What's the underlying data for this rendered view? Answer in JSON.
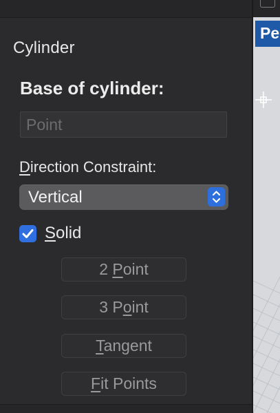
{
  "panel": {
    "title": "Cylinder",
    "base_label": "Base of cylinder:",
    "point_placeholder": "Point",
    "direction_label": {
      "mnemonic": "D",
      "rest": "irection Constraint:"
    },
    "direction_value": "Vertical",
    "solid": {
      "checked": true,
      "mnemonic": "S",
      "rest": "olid"
    },
    "buttons": {
      "two_point": {
        "pre": "2 ",
        "mnemonic": "P",
        "post": "oint"
      },
      "three_point": {
        "pre": "3 P",
        "mnemonic": "o",
        "post": "int"
      },
      "tangent": {
        "pre": "",
        "mnemonic": "T",
        "post": "angent"
      },
      "fit_points": {
        "pre": "",
        "mnemonic": "F",
        "post": "it Points"
      }
    }
  },
  "viewport": {
    "tab_text": "Pe"
  },
  "colors": {
    "panel_bg": "#2b2b2d",
    "accent_blue": "#2f6fdf",
    "viewport_tab": "#1e5aa8",
    "viewport_bg": "#d7d9dc"
  },
  "icons": {
    "select_stepper": "chevron-up-down-icon",
    "checkbox_mark": "checkmark-icon",
    "viewport_cursor": "crosshair-icon"
  }
}
